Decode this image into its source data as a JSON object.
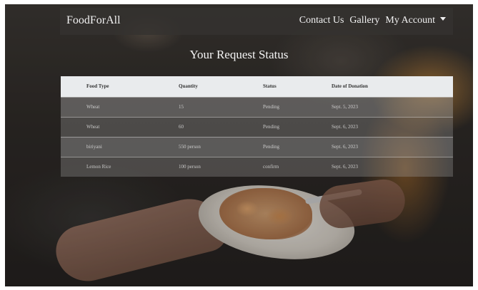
{
  "navbar": {
    "brand": "FoodForAll",
    "links": [
      "Contact Us",
      "Gallery",
      "My Account"
    ]
  },
  "page": {
    "title": "Your Request Status"
  },
  "table": {
    "headers": [
      "Food Type",
      "Quantity",
      "Status",
      "Date of Donation"
    ],
    "rows": [
      [
        "Wheat",
        "15",
        "Pending",
        "Sept. 5, 2023"
      ],
      [
        "Wheat",
        "60",
        "Pending",
        "Sept. 6, 2023"
      ],
      [
        "biriyani",
        "550 person",
        "Pending",
        "Sept. 6, 2023"
      ],
      [
        "Lemon Rice",
        "100 person",
        "confirm",
        "Sept. 6, 2023"
      ]
    ]
  },
  "icons": {
    "dropdown": "caret-down-icon"
  },
  "colors": {
    "navbar_bg": "#343230",
    "table_header_bg": "#e9ebed",
    "text_light": "#f2f2f2"
  }
}
